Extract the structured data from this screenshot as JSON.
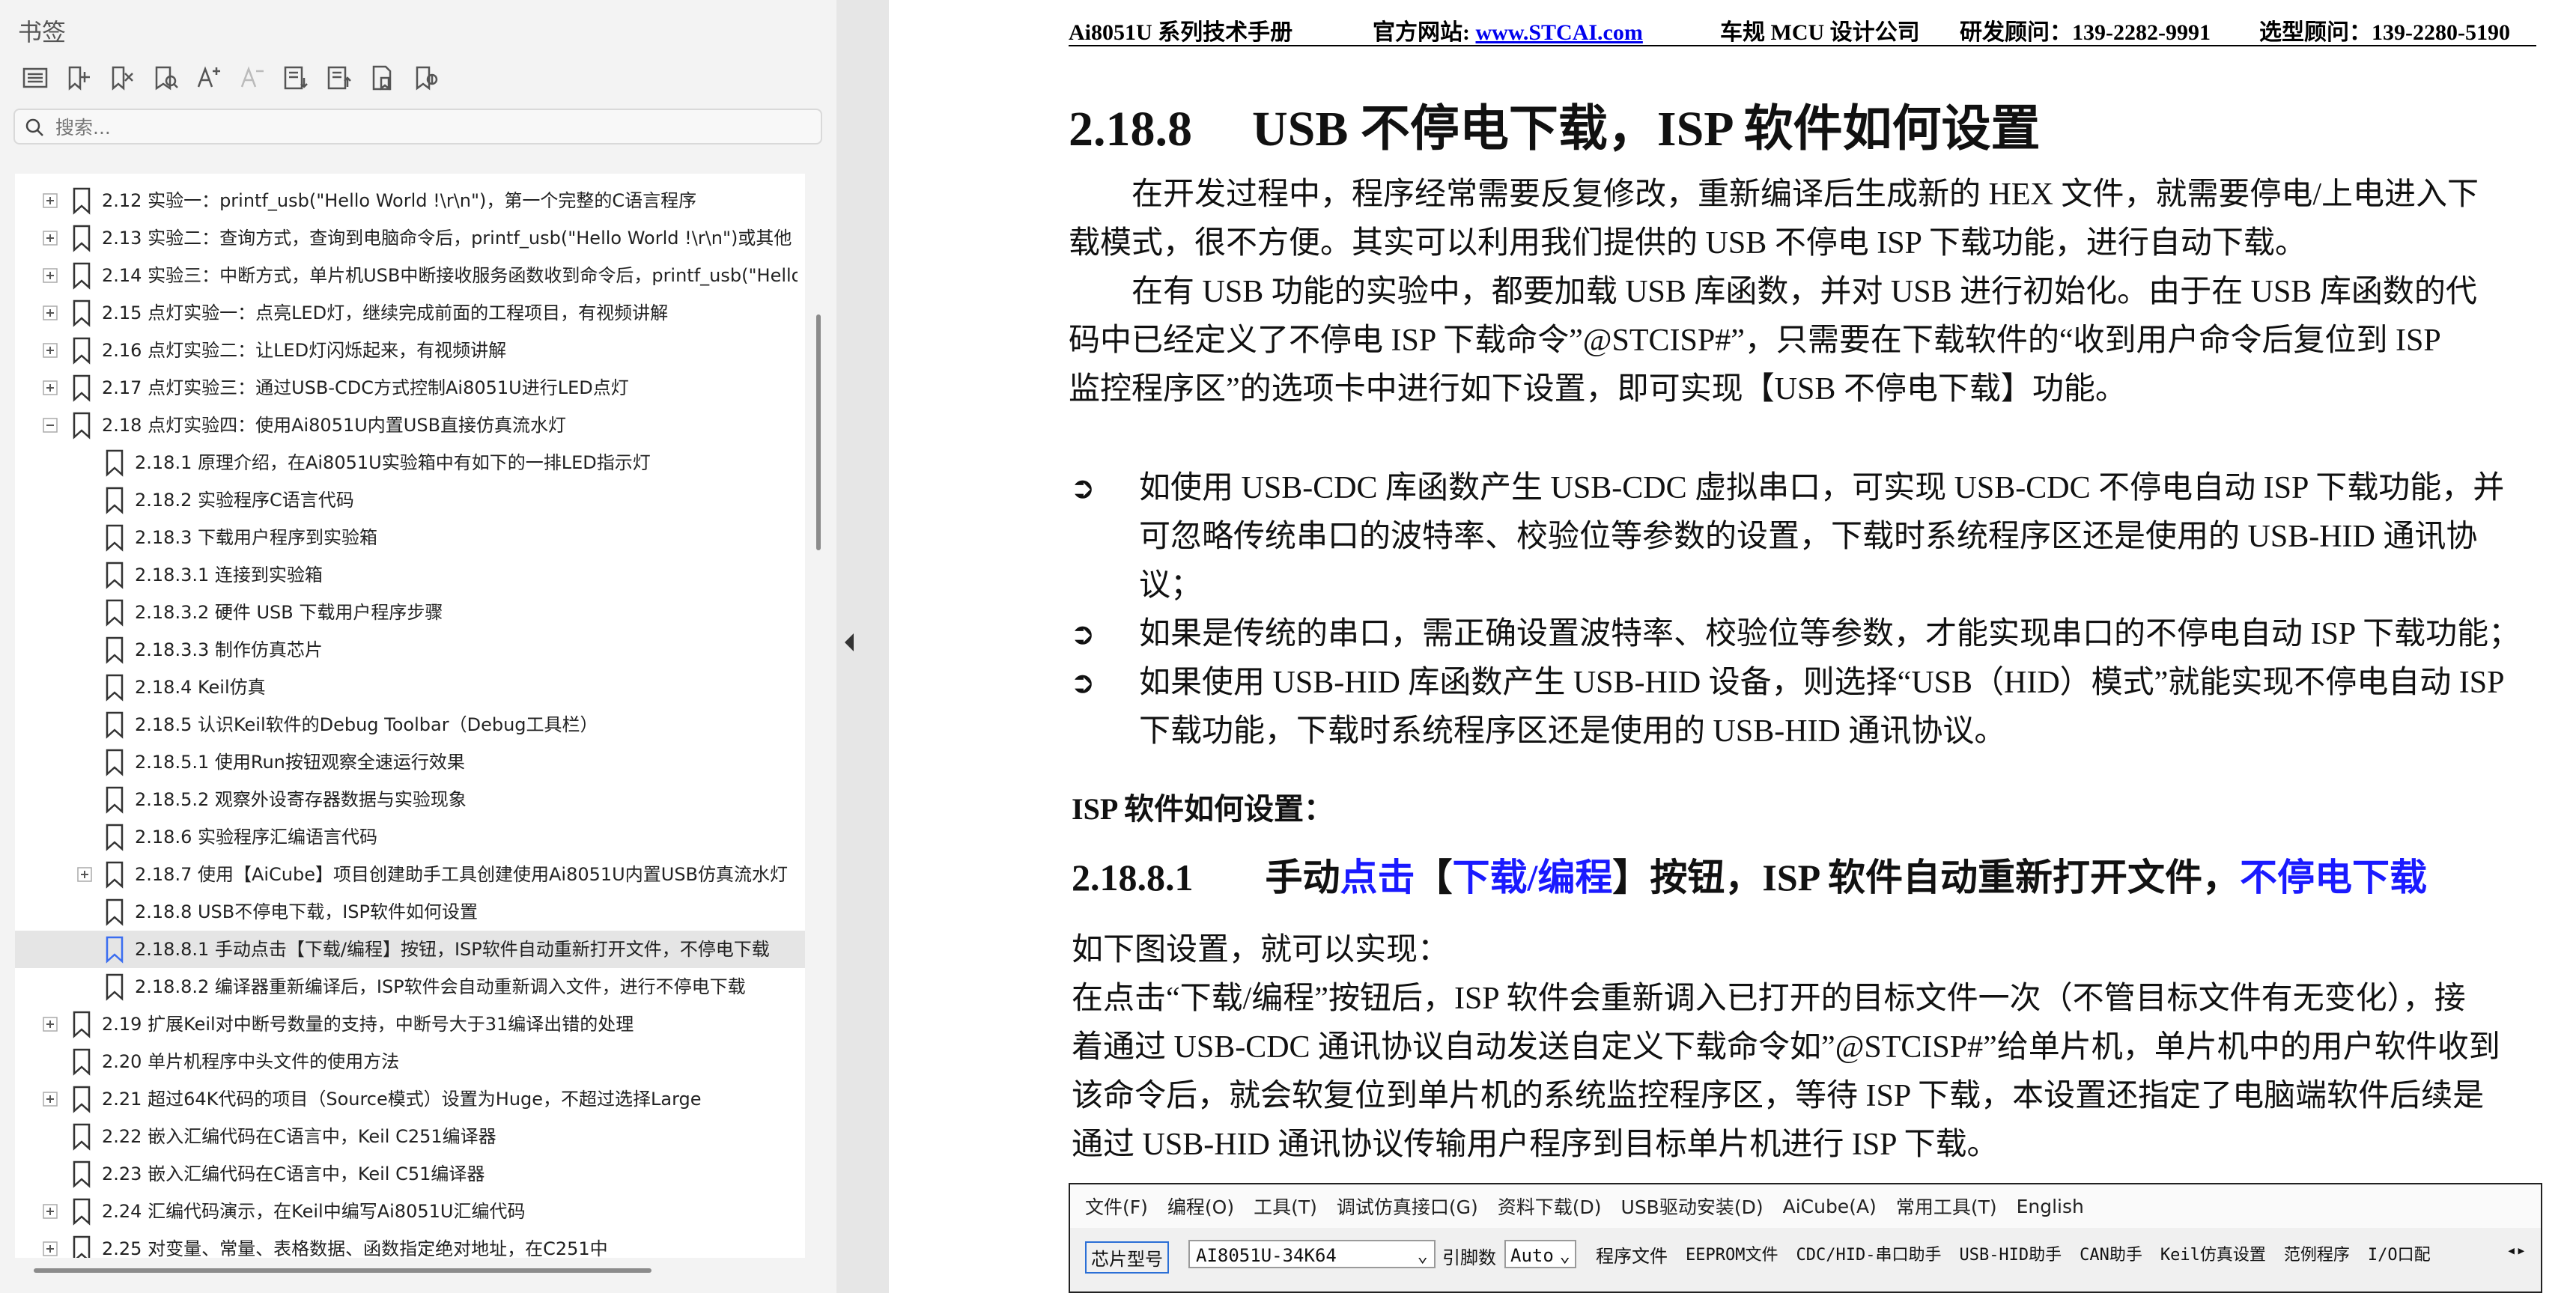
{
  "panel": {
    "title": "书签",
    "search_placeholder": "搜索...",
    "tools": [
      "outline-icon",
      "add-bookmark-icon",
      "delete-bookmark-icon",
      "find-bookmark-icon",
      "font-larger-icon",
      "font-smaller-icon",
      "expand-all-icon",
      "collapse-all-icon",
      "page-bookmark-icon",
      "goto-bookmark-icon"
    ]
  },
  "bookmarks": [
    {
      "label": "2.12  实验一：printf_usb(\"Hello World !\\r\\n\")，第一个完整的C语言程序",
      "level": 1,
      "expander": "plus"
    },
    {
      "label": "2.13  实验二：查询方式，查询到电脑命令后，printf_usb(\"Hello World !\\r\\n\")或其他",
      "level": 1,
      "expander": "plus"
    },
    {
      "label": "2.14  实验三：中断方式，单片机USB中断接收服务函数收到命令后，printf_usb(\"Hello",
      "level": 1,
      "expander": "plus"
    },
    {
      "label": "2.15  点灯实验一：点亮LED灯，继续完成前面的工程项目，有视频讲解",
      "level": 1,
      "expander": "plus"
    },
    {
      "label": "2.16  点灯实验二：让LED灯闪烁起来，有视频讲解",
      "level": 1,
      "expander": "plus"
    },
    {
      "label": "2.17  点灯实验三：通过USB-CDC方式控制Ai8051U进行LED点灯",
      "level": 1,
      "expander": "plus"
    },
    {
      "label": "2.18  点灯实验四：使用Ai8051U内置USB直接仿真流水灯",
      "level": 1,
      "expander": "minus"
    },
    {
      "label": "2.18.1 原理介绍，在Ai8051U实验箱中有如下的一排LED指示灯",
      "level": 2,
      "expander": "none"
    },
    {
      "label": "2.18.2 实验程序C语言代码",
      "level": 2,
      "expander": "none"
    },
    {
      "label": "2.18.3  下载用户程序到实验箱",
      "level": 2,
      "expander": "none"
    },
    {
      "label": "2.18.3.1 连接到实验箱",
      "level": 2,
      "expander": "none"
    },
    {
      "label": "2.18.3.2 硬件 USB 下载用户程序步骤",
      "level": 2,
      "expander": "none"
    },
    {
      "label": "2.18.3.3  制作仿真芯片",
      "level": 2,
      "expander": "none"
    },
    {
      "label": "2.18.4 Keil仿真",
      "level": 2,
      "expander": "none"
    },
    {
      "label": "2.18.5  认识Keil软件的Debug Toolbar（Debug工具栏）",
      "level": 2,
      "expander": "none"
    },
    {
      "label": "2.18.5.1  使用Run按钮观察全速运行效果",
      "level": 2,
      "expander": "none"
    },
    {
      "label": "2.18.5.2 观察外设寄存器数据与实验现象",
      "level": 2,
      "expander": "none"
    },
    {
      "label": "2.18.6  实验程序汇编语言代码",
      "level": 2,
      "expander": "none"
    },
    {
      "label": "2.18.7  使用【AiCube】项目创建助手工具创建使用Ai8051U内置USB仿真流水灯",
      "level": 2,
      "expander": "plus"
    },
    {
      "label": "2.18.8  USB不停电下载，ISP软件如何设置",
      "level": 2,
      "expander": "none"
    },
    {
      "label": "2.18.8.1 手动点击【下载/编程】按钮，ISP软件自动重新打开文件，不停电下载",
      "level": 2,
      "expander": "none",
      "selected": true
    },
    {
      "label": "2.18.8.2  编译器重新编译后，ISP软件会自动重新调入文件，进行不停电下载",
      "level": 2,
      "expander": "none"
    },
    {
      "label": "2.19  扩展Keil对中断号数量的支持，中断号大于31编译出错的处理",
      "level": 1,
      "expander": "plus"
    },
    {
      "label": "2.20  单片机程序中头文件的使用方法",
      "level": 1,
      "expander": "none"
    },
    {
      "label": "2.21  超过64K代码的项目（Source模式）设置为Huge，不超过选择Large",
      "level": 1,
      "expander": "plus"
    },
    {
      "label": "2.22  嵌入汇编代码在C语言中，Keil C251编译器",
      "level": 1,
      "expander": "none"
    },
    {
      "label": "2.23  嵌入汇编代码在C语言中，Keil C51编译器",
      "level": 1,
      "expander": "none"
    },
    {
      "label": "2.24  汇编代码演示，在Keil中编写Ai8051U汇编代码",
      "level": 1,
      "expander": "plus"
    },
    {
      "label": "2.25  对变量、常量、表格数据、函数指定绝对地址，在C251中",
      "level": 1,
      "expander": "plus"
    }
  ],
  "doc": {
    "header": {
      "manual": "Ai8051U 系列技术手册",
      "site_label": "官方网站: ",
      "site_url": "www.STCAI.com",
      "company": "车规 MCU 设计公司",
      "rd_contact": "研发顾问：139-2282-9991",
      "sales_contact": "选型顾问：139-2280-5190"
    },
    "section_num": "2.18.8",
    "section_title": "USB 不停电下载，ISP 软件如何设置",
    "para1_l1": "在开发过程中，程序经常需要反复修改，重新编译后生成新的 HEX 文件，就需要停电/上电进入下",
    "para1_l2": "载模式，很不方便。其实可以利用我们提供的 USB 不停电 ISP 下载功能，进行自动下载。",
    "para2_l1": "在有 USB 功能的实验中，都要加载 USB 库函数，并对 USB 进行初始化。由于在 USB 库函数的代",
    "para2_l2": "码中已经定义了不停电  ISP  下载命令”@STCISP#”，只需要在下载软件的“收到用户命令后复位到  ISP",
    "para2_l3": "监控程序区”的选项卡中进行如下设置，即可实现【USB 不停电下载】功能。",
    "bullet1_l1": "如使用 USB-CDC 库函数产生 USB-CDC 虚拟串口，可实现 USB-CDC 不停电自动 ISP 下载功能，并",
    "bullet1_l2": "可忽略传统串口的波特率、校验位等参数的设置，下载时系统程序区还是使用的  USB-HID  通讯协",
    "bullet1_l3": "议；",
    "bullet2_l1": "如果是传统的串口，需正确设置波特率、校验位等参数，才能实现串口的不停电自动 ISP 下载功能；",
    "bullet3_l1": "如果使用 USB-HID 库函数产生 USB-HID 设备，则选择“USB（HID）模式”就能实现不停电自动 ISP",
    "bullet3_l2": "下载功能，下载时系统程序区还是使用的 USB-HID 通讯协议。",
    "bullet_glyph": "➲",
    "isp_heading": "ISP 软件如何设置：",
    "sub_num": "2.18.8.1",
    "sub_t1": "手动",
    "sub_t2": "点击",
    "sub_t3": "【",
    "sub_t4": "下载/编程",
    "sub_t5": "】按钮，ISP 软件自动重新打开文件，",
    "sub_t6": "不停电下载",
    "para3_l1": "如下图设置，就可以实现：",
    "para4_l1": "在点击“下载/编程”按钮后，ISP 软件会重新调入已打开的目标文件一次（不管目标文件有无变化），接",
    "para4_l2": "着通过 USB-CDC 通讯协议自动发送自定义下载命令如”@STCISP#”给单片机，单片机中的用户软件收到",
    "para4_l3": "该命令后，就会软复位到单片机的系统监控程序区，等待 ISP 下载，本设置还指定了电脑端软件后续是",
    "para4_l4": "通过 USB-HID 通讯协议传输用户程序到目标单片机进行 ISP 下载。"
  },
  "isp": {
    "menus": [
      "文件(F)",
      "编程(O)",
      "工具(T)",
      "调试仿真接口(G)",
      "资料下载(D)",
      "USB驱动安装(D)",
      "AiCube(A)",
      "常用工具(T)",
      "English"
    ],
    "chip_label": "芯片型号",
    "chip_value": "AI8051U-34K64",
    "pins_label": "引脚数",
    "pins_value": "Auto",
    "tabs": [
      "程序文件",
      "EEPROM文件",
      "CDC/HID-串口助手",
      "USB-HID助手",
      "CAN助手",
      "Keil仿真设置",
      "范例程序",
      "I/O口配"
    ]
  }
}
